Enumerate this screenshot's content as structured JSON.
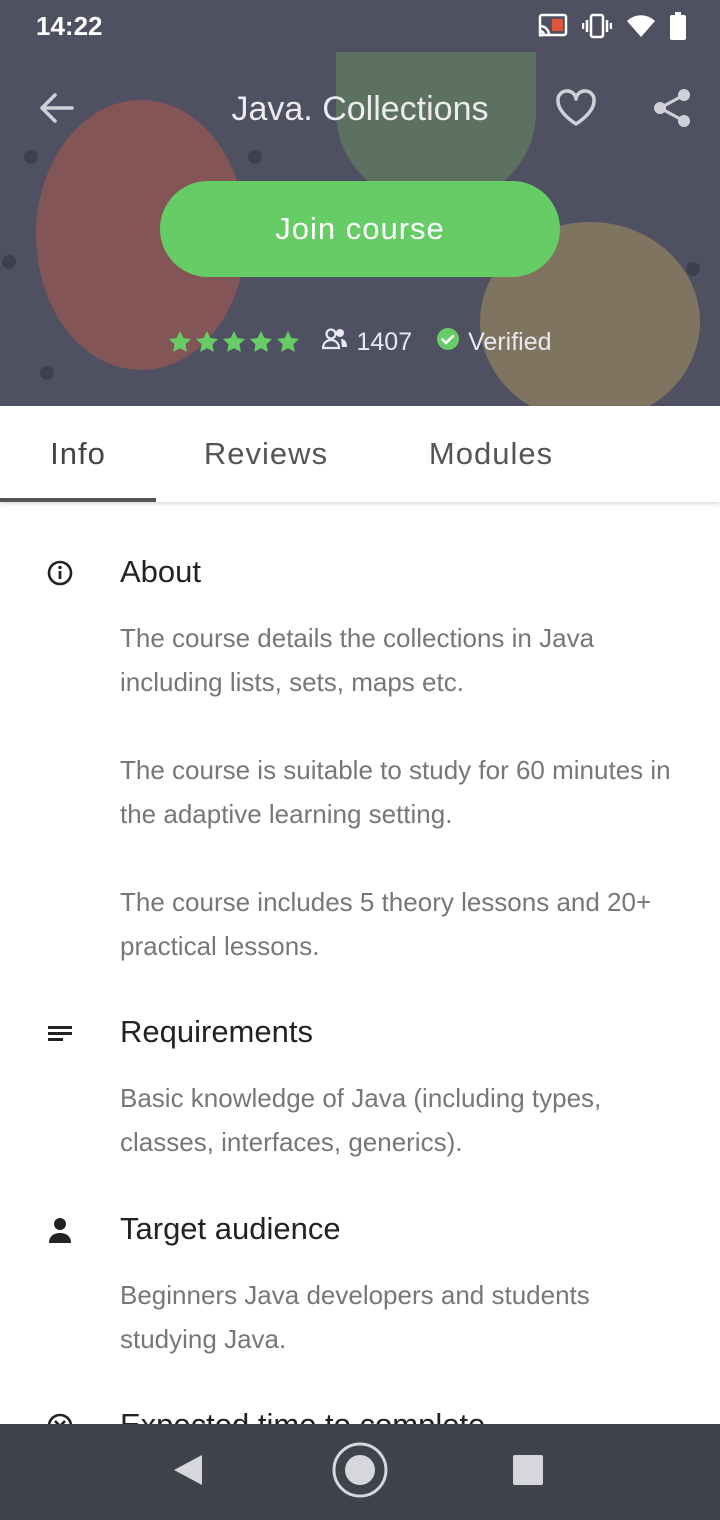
{
  "status_bar": {
    "time": "14:22",
    "icons": [
      "cast-icon",
      "vibrate-icon",
      "wifi-icon",
      "battery-icon"
    ]
  },
  "toolbar": {
    "title": "Java. Collections",
    "icons": [
      "back-arrow-icon",
      "heart-icon",
      "share-icon"
    ]
  },
  "course": {
    "join_label": "Join course",
    "rating_stars": 5,
    "learners_count": "1407",
    "verified_label": "Verified"
  },
  "tabs": [
    {
      "label": "Info",
      "selected": true
    },
    {
      "label": "Reviews",
      "selected": false
    },
    {
      "label": "Modules",
      "selected": false
    }
  ],
  "sections": {
    "about": {
      "icon": "info-icon",
      "title": "About",
      "paragraphs": [
        "The course details the collections in Java including lists, sets, maps etc.",
        "The course is suitable to study for 60 minutes in the adaptive learning setting.",
        "The course includes 5 theory lessons and 20+ practical lessons."
      ]
    },
    "requirements": {
      "icon": "list-icon",
      "title": "Requirements",
      "body": "Basic knowledge of Java (including types, classes, interfaces, generics)."
    },
    "audience": {
      "icon": "person-icon",
      "title": "Target audience",
      "body": "Beginners Java developers and students studying Java."
    },
    "time": {
      "icon": "clock-icon",
      "title": "Expected time to complete"
    }
  },
  "colors": {
    "accent_green": "#66cc66",
    "header_bg": "#4f5061",
    "nav_bg": "#3f434b"
  }
}
